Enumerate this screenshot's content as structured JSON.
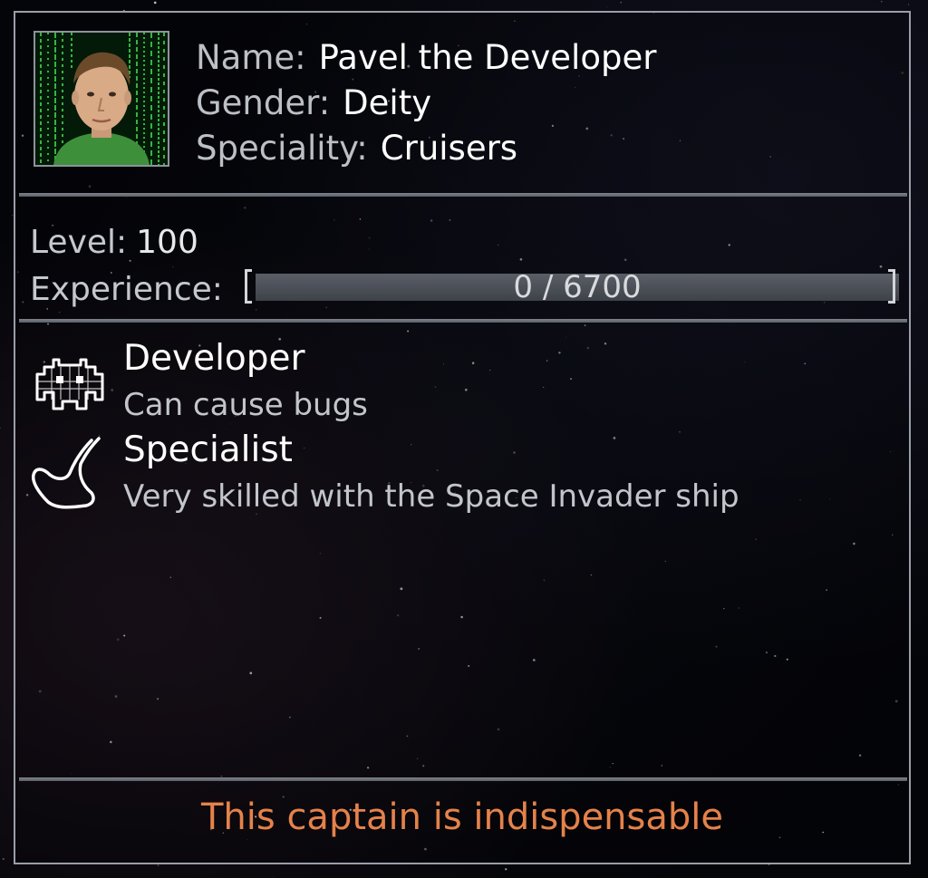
{
  "captain": {
    "portrait_icon": "developer-portrait",
    "name_label": "Name:",
    "name_value": "Pavel the Developer",
    "gender_label": "Gender:",
    "gender_value": "Deity",
    "speciality_label": "Speciality:",
    "speciality_value": "Cruisers"
  },
  "stats": {
    "level_label": "Level:",
    "level_value": "100",
    "experience_label": "Experience:",
    "experience_text": "0 / 6700",
    "experience_current": 0,
    "experience_max": 6700
  },
  "traits": [
    {
      "icon": "space-invader-icon",
      "title": "Developer",
      "description": "Can cause bugs"
    },
    {
      "icon": "pointing-hand-icon",
      "title": "Specialist",
      "description": "Very skilled with the Space Invader ship"
    }
  ],
  "footer": {
    "status_text": "This captain is indispensable"
  },
  "colors": {
    "accent_orange": "#e5824a",
    "panel_border": "#9a9ea8",
    "matrix_green": "#3fd04a"
  }
}
